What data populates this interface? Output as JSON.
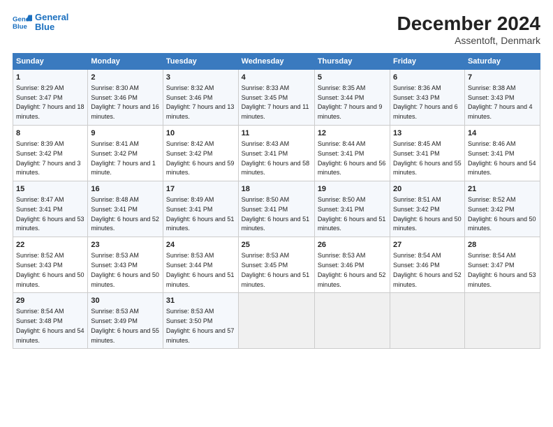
{
  "header": {
    "logo_line1": "General",
    "logo_line2": "Blue",
    "title": "December 2024",
    "subtitle": "Assentoft, Denmark"
  },
  "calendar": {
    "weekdays": [
      "Sunday",
      "Monday",
      "Tuesday",
      "Wednesday",
      "Thursday",
      "Friday",
      "Saturday"
    ],
    "weeks": [
      [
        {
          "day": "1",
          "sunrise": "Sunrise: 8:29 AM",
          "sunset": "Sunset: 3:47 PM",
          "daylight": "Daylight: 7 hours and 18 minutes."
        },
        {
          "day": "2",
          "sunrise": "Sunrise: 8:30 AM",
          "sunset": "Sunset: 3:46 PM",
          "daylight": "Daylight: 7 hours and 16 minutes."
        },
        {
          "day": "3",
          "sunrise": "Sunrise: 8:32 AM",
          "sunset": "Sunset: 3:46 PM",
          "daylight": "Daylight: 7 hours and 13 minutes."
        },
        {
          "day": "4",
          "sunrise": "Sunrise: 8:33 AM",
          "sunset": "Sunset: 3:45 PM",
          "daylight": "Daylight: 7 hours and 11 minutes."
        },
        {
          "day": "5",
          "sunrise": "Sunrise: 8:35 AM",
          "sunset": "Sunset: 3:44 PM",
          "daylight": "Daylight: 7 hours and 9 minutes."
        },
        {
          "day": "6",
          "sunrise": "Sunrise: 8:36 AM",
          "sunset": "Sunset: 3:43 PM",
          "daylight": "Daylight: 7 hours and 6 minutes."
        },
        {
          "day": "7",
          "sunrise": "Sunrise: 8:38 AM",
          "sunset": "Sunset: 3:43 PM",
          "daylight": "Daylight: 7 hours and 4 minutes."
        }
      ],
      [
        {
          "day": "8",
          "sunrise": "Sunrise: 8:39 AM",
          "sunset": "Sunset: 3:42 PM",
          "daylight": "Daylight: 7 hours and 3 minutes."
        },
        {
          "day": "9",
          "sunrise": "Sunrise: 8:41 AM",
          "sunset": "Sunset: 3:42 PM",
          "daylight": "Daylight: 7 hours and 1 minute."
        },
        {
          "day": "10",
          "sunrise": "Sunrise: 8:42 AM",
          "sunset": "Sunset: 3:42 PM",
          "daylight": "Daylight: 6 hours and 59 minutes."
        },
        {
          "day": "11",
          "sunrise": "Sunrise: 8:43 AM",
          "sunset": "Sunset: 3:41 PM",
          "daylight": "Daylight: 6 hours and 58 minutes."
        },
        {
          "day": "12",
          "sunrise": "Sunrise: 8:44 AM",
          "sunset": "Sunset: 3:41 PM",
          "daylight": "Daylight: 6 hours and 56 minutes."
        },
        {
          "day": "13",
          "sunrise": "Sunrise: 8:45 AM",
          "sunset": "Sunset: 3:41 PM",
          "daylight": "Daylight: 6 hours and 55 minutes."
        },
        {
          "day": "14",
          "sunrise": "Sunrise: 8:46 AM",
          "sunset": "Sunset: 3:41 PM",
          "daylight": "Daylight: 6 hours and 54 minutes."
        }
      ],
      [
        {
          "day": "15",
          "sunrise": "Sunrise: 8:47 AM",
          "sunset": "Sunset: 3:41 PM",
          "daylight": "Daylight: 6 hours and 53 minutes."
        },
        {
          "day": "16",
          "sunrise": "Sunrise: 8:48 AM",
          "sunset": "Sunset: 3:41 PM",
          "daylight": "Daylight: 6 hours and 52 minutes."
        },
        {
          "day": "17",
          "sunrise": "Sunrise: 8:49 AM",
          "sunset": "Sunset: 3:41 PM",
          "daylight": "Daylight: 6 hours and 51 minutes."
        },
        {
          "day": "18",
          "sunrise": "Sunrise: 8:50 AM",
          "sunset": "Sunset: 3:41 PM",
          "daylight": "Daylight: 6 hours and 51 minutes."
        },
        {
          "day": "19",
          "sunrise": "Sunrise: 8:50 AM",
          "sunset": "Sunset: 3:41 PM",
          "daylight": "Daylight: 6 hours and 51 minutes."
        },
        {
          "day": "20",
          "sunrise": "Sunrise: 8:51 AM",
          "sunset": "Sunset: 3:42 PM",
          "daylight": "Daylight: 6 hours and 50 minutes."
        },
        {
          "day": "21",
          "sunrise": "Sunrise: 8:52 AM",
          "sunset": "Sunset: 3:42 PM",
          "daylight": "Daylight: 6 hours and 50 minutes."
        }
      ],
      [
        {
          "day": "22",
          "sunrise": "Sunrise: 8:52 AM",
          "sunset": "Sunset: 3:43 PM",
          "daylight": "Daylight: 6 hours and 50 minutes."
        },
        {
          "day": "23",
          "sunrise": "Sunrise: 8:53 AM",
          "sunset": "Sunset: 3:43 PM",
          "daylight": "Daylight: 6 hours and 50 minutes."
        },
        {
          "day": "24",
          "sunrise": "Sunrise: 8:53 AM",
          "sunset": "Sunset: 3:44 PM",
          "daylight": "Daylight: 6 hours and 51 minutes."
        },
        {
          "day": "25",
          "sunrise": "Sunrise: 8:53 AM",
          "sunset": "Sunset: 3:45 PM",
          "daylight": "Daylight: 6 hours and 51 minutes."
        },
        {
          "day": "26",
          "sunrise": "Sunrise: 8:53 AM",
          "sunset": "Sunset: 3:46 PM",
          "daylight": "Daylight: 6 hours and 52 minutes."
        },
        {
          "day": "27",
          "sunrise": "Sunrise: 8:54 AM",
          "sunset": "Sunset: 3:46 PM",
          "daylight": "Daylight: 6 hours and 52 minutes."
        },
        {
          "day": "28",
          "sunrise": "Sunrise: 8:54 AM",
          "sunset": "Sunset: 3:47 PM",
          "daylight": "Daylight: 6 hours and 53 minutes."
        }
      ],
      [
        {
          "day": "29",
          "sunrise": "Sunrise: 8:54 AM",
          "sunset": "Sunset: 3:48 PM",
          "daylight": "Daylight: 6 hours and 54 minutes."
        },
        {
          "day": "30",
          "sunrise": "Sunrise: 8:53 AM",
          "sunset": "Sunset: 3:49 PM",
          "daylight": "Daylight: 6 hours and 55 minutes."
        },
        {
          "day": "31",
          "sunrise": "Sunrise: 8:53 AM",
          "sunset": "Sunset: 3:50 PM",
          "daylight": "Daylight: 6 hours and 57 minutes."
        },
        null,
        null,
        null,
        null
      ]
    ]
  }
}
